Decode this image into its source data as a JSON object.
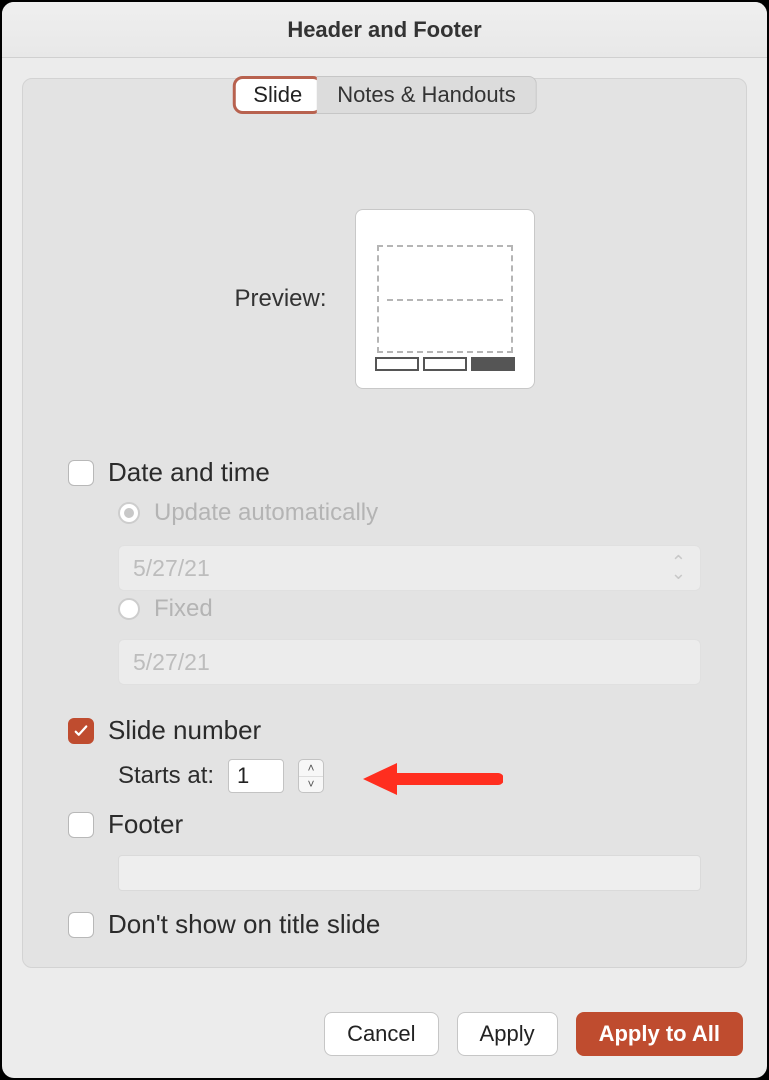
{
  "title": "Header and Footer",
  "tabs": {
    "slide": "Slide",
    "notes": "Notes & Handouts"
  },
  "preview": {
    "label": "Preview:"
  },
  "dateTime": {
    "label": "Date and time",
    "checked": false,
    "updateAuto": "Update automatically",
    "autoValue": "5/27/21",
    "fixed": "Fixed",
    "fixedValue": "5/27/21"
  },
  "slideNumber": {
    "label": "Slide number",
    "checked": true,
    "startsAtLabel": "Starts at:",
    "startsAtValue": "1"
  },
  "footer": {
    "label": "Footer",
    "checked": false,
    "value": ""
  },
  "dontShow": {
    "label": "Don't show on title slide",
    "checked": false
  },
  "buttons": {
    "cancel": "Cancel",
    "apply": "Apply",
    "applyAll": "Apply to All"
  }
}
